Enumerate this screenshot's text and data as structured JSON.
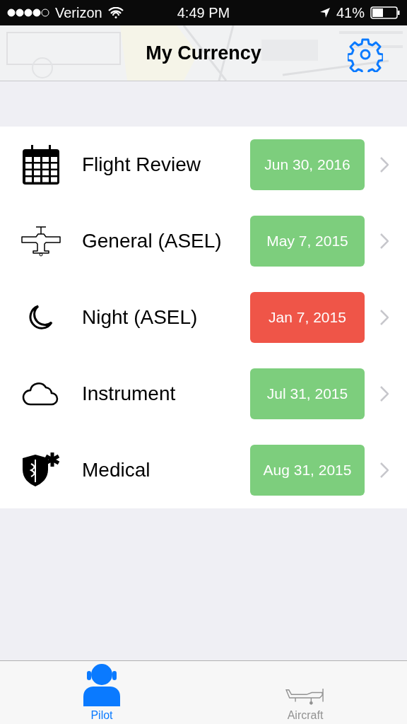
{
  "status_bar": {
    "carrier": "Verizon",
    "time": "4:49 PM",
    "battery": "41%"
  },
  "nav": {
    "title": "My Currency"
  },
  "items": [
    {
      "kind": "calendar",
      "label": "Flight Review",
      "date": "Jun 30, 2016",
      "color": "#7dce7d"
    },
    {
      "kind": "plane",
      "label": "General (ASEL)",
      "date": "May 7, 2015",
      "color": "#7dce7d"
    },
    {
      "kind": "moon",
      "label": "Night (ASEL)",
      "date": "Jan 7, 2015",
      "color": "#ef5548"
    },
    {
      "kind": "cloud",
      "label": "Instrument",
      "date": "Jul 31, 2015",
      "color": "#7dce7d"
    },
    {
      "kind": "medical",
      "label": "Medical",
      "date": "Aug 31, 2015",
      "color": "#7dce7d"
    }
  ],
  "tabs": [
    {
      "kind": "pilot",
      "label": "Pilot",
      "selected": true
    },
    {
      "kind": "aircraft",
      "label": "Aircraft",
      "selected": false
    }
  ]
}
